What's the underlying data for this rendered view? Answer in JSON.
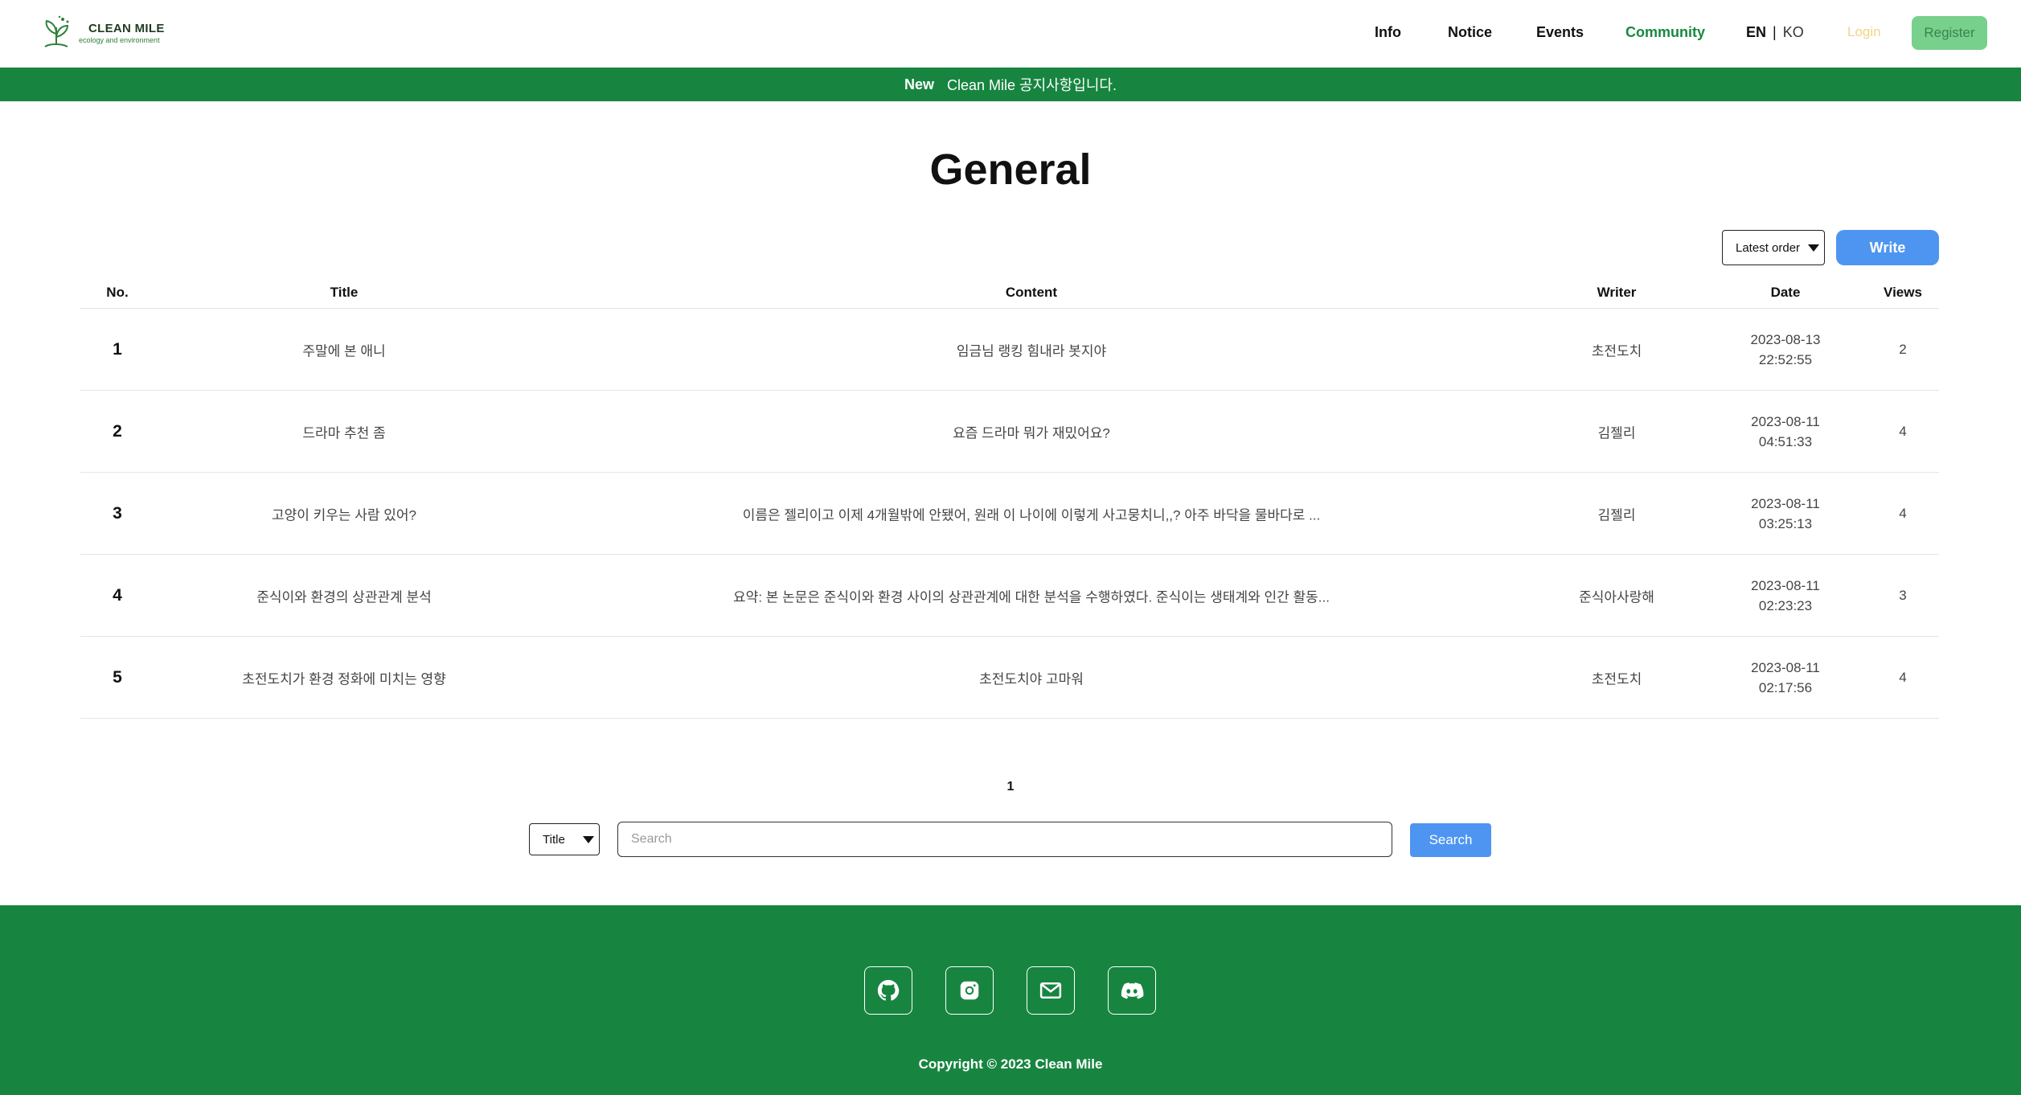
{
  "brand": {
    "name": "CLEAN MILE",
    "tagline": "ecology and environment"
  },
  "nav": {
    "items": [
      "Info",
      "Notice",
      "Events",
      "Community"
    ],
    "active": "Community"
  },
  "lang": {
    "en": "EN",
    "sep": "|",
    "ko": "KO"
  },
  "auth": {
    "login": "Login",
    "register": "Register"
  },
  "notice_bar": {
    "badge": "New",
    "text": "Clean Mile 공지사항입니다."
  },
  "page": {
    "title": "General"
  },
  "toolbar": {
    "sort_value": "Latest order",
    "write": "Write"
  },
  "table": {
    "headers": {
      "no": "No.",
      "title": "Title",
      "content": "Content",
      "writer": "Writer",
      "date": "Date",
      "views": "Views"
    },
    "rows": [
      {
        "no": "1",
        "title": "주말에 본 애니",
        "content": "임금님 랭킹 힘내라 봇지야",
        "writer": "초전도치",
        "date": "2023-08-13",
        "time": "22:52:55",
        "views": "2"
      },
      {
        "no": "2",
        "title": "드라마 추천 좀",
        "content": "요즘 드라마 뭐가 재밌어요?",
        "writer": "김젤리",
        "date": "2023-08-11",
        "time": "04:51:33",
        "views": "4"
      },
      {
        "no": "3",
        "title": "고양이 키우는 사람 있어?",
        "content": "이름은 젤리이고 이제 4개월밖에 안됐어, 원래 이 나이에 이렇게 사고뭉치니,,? 아주 바닥을 물바다로 ...",
        "writer": "김젤리",
        "date": "2023-08-11",
        "time": "03:25:13",
        "views": "4"
      },
      {
        "no": "4",
        "title": "준식이와 환경의 상관관계 분석",
        "content": "요약: 본 논문은 준식이와 환경 사이의 상관관계에 대한 분석을 수행하였다. 준식이는 생태계와 인간 활동...",
        "writer": "준식아사랑해",
        "date": "2023-08-11",
        "time": "02:23:23",
        "views": "3"
      },
      {
        "no": "5",
        "title": "초전도치가 환경 정화에 미치는 영향",
        "content": "초전도치야 고마워",
        "writer": "초전도치",
        "date": "2023-08-11",
        "time": "02:17:56",
        "views": "4"
      }
    ]
  },
  "pagination": {
    "current": "1"
  },
  "search": {
    "type": "Title",
    "placeholder": "Search",
    "button": "Search"
  },
  "footer": {
    "icons": [
      "github-icon",
      "instagram-icon",
      "mail-icon",
      "discord-icon"
    ],
    "copyright": "Copyright © 2023 Clean Mile"
  },
  "colors": {
    "primary_green": "#178540",
    "accent_blue": "#4e95f1",
    "register_bg": "#77d08b",
    "login_text": "#f2d489"
  }
}
